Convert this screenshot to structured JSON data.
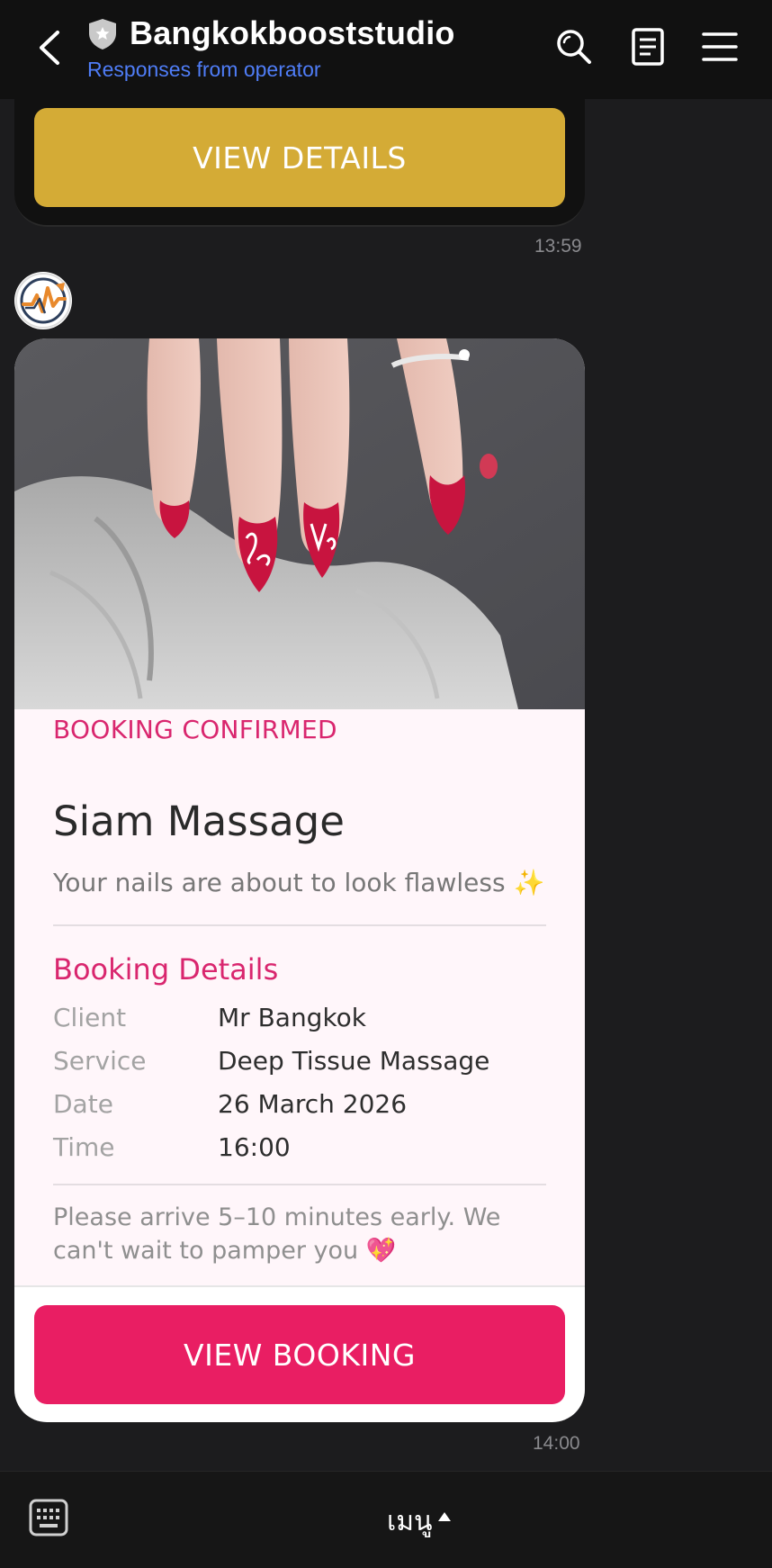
{
  "header": {
    "title": "Bangkokbooststudio",
    "subtitle": "Responses from operator"
  },
  "previous_message": {
    "button_label": "VIEW DETAILS",
    "time": "13:59"
  },
  "booking_card": {
    "kicker": "BOOKING CONFIRMED",
    "business_name": "Siam Massage",
    "tagline": "Your nails are about to look flawless ✨",
    "section_title": "Booking Details",
    "rows": [
      {
        "label": "Client",
        "value": "Mr Bangkok"
      },
      {
        "label": "Service",
        "value": "Deep Tissue Massage"
      },
      {
        "label": "Date",
        "value": "26 March 2026"
      },
      {
        "label": "Time",
        "value": "16:00"
      }
    ],
    "note": "Please arrive 5–10 minutes early. We can't wait to pamper you 💖",
    "button_label": "VIEW BOOKING",
    "time": "14:00"
  },
  "bottom_bar": {
    "menu_label": "เมนู"
  },
  "colors": {
    "accent_pink": "#e91e63",
    "gold": "#d4ab36",
    "link_blue": "#4f7df7"
  }
}
